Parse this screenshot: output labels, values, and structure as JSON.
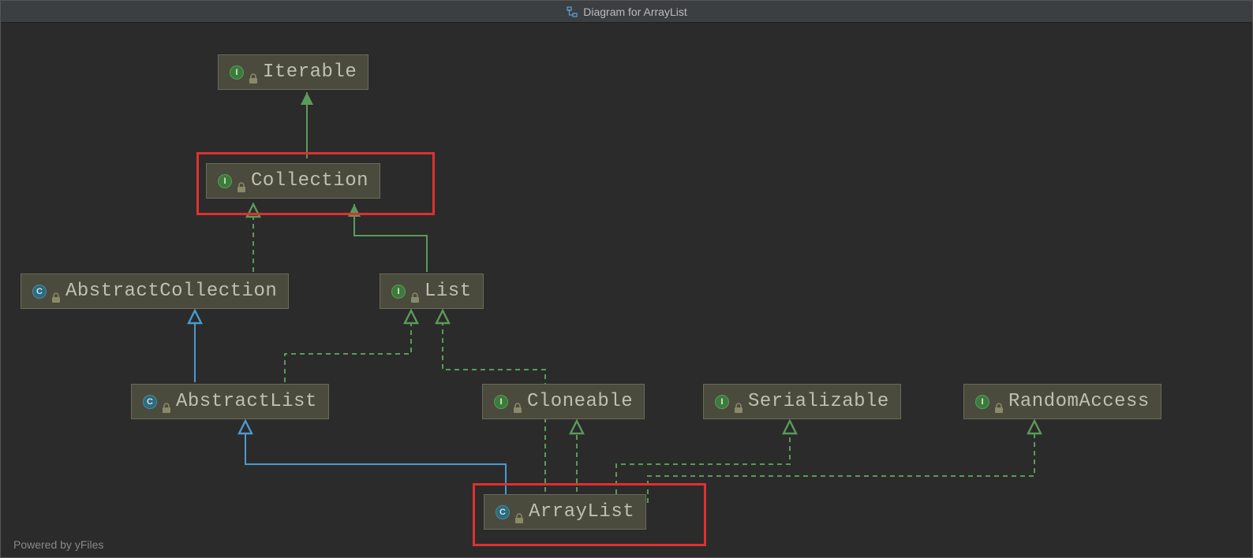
{
  "title": "Diagram for ArrayList",
  "footer": "Powered by yFiles",
  "nodes": {
    "iterable": {
      "label": "Iterable",
      "type": "I"
    },
    "collection": {
      "label": "Collection",
      "type": "I"
    },
    "abstractCollection": {
      "label": "AbstractCollection",
      "type": "C"
    },
    "list": {
      "label": "List",
      "type": "I"
    },
    "abstractList": {
      "label": "AbstractList",
      "type": "C"
    },
    "cloneable": {
      "label": "Cloneable",
      "type": "I"
    },
    "serializable": {
      "label": "Serializable",
      "type": "I"
    },
    "randomAccess": {
      "label": "RandomAccess",
      "type": "I"
    },
    "arrayList": {
      "label": "ArrayList",
      "type": "C"
    }
  },
  "edges": [
    {
      "from": "collection",
      "to": "iterable",
      "style": "solid-green"
    },
    {
      "from": "abstractCollection",
      "to": "collection",
      "style": "dashed-green"
    },
    {
      "from": "list",
      "to": "collection",
      "style": "solid-green"
    },
    {
      "from": "abstractList",
      "to": "abstractCollection",
      "style": "solid-blue"
    },
    {
      "from": "abstractList",
      "to": "list",
      "style": "dashed-green"
    },
    {
      "from": "arrayList",
      "to": "abstractList",
      "style": "solid-blue"
    },
    {
      "from": "arrayList",
      "to": "list",
      "style": "dashed-green"
    },
    {
      "from": "arrayList",
      "to": "cloneable",
      "style": "dashed-green"
    },
    {
      "from": "arrayList",
      "to": "serializable",
      "style": "dashed-green"
    },
    {
      "from": "arrayList",
      "to": "randomAccess",
      "style": "dashed-green"
    }
  ],
  "highlighted": [
    "collection",
    "arrayList"
  ],
  "chart_data": {
    "type": "diagram",
    "description": "Java class hierarchy diagram for ArrayList showing inheritance and interface implementation",
    "nodes": [
      {
        "id": "Iterable",
        "kind": "interface"
      },
      {
        "id": "Collection",
        "kind": "interface"
      },
      {
        "id": "AbstractCollection",
        "kind": "abstract-class"
      },
      {
        "id": "List",
        "kind": "interface"
      },
      {
        "id": "AbstractList",
        "kind": "abstract-class"
      },
      {
        "id": "Cloneable",
        "kind": "interface"
      },
      {
        "id": "Serializable",
        "kind": "interface"
      },
      {
        "id": "RandomAccess",
        "kind": "interface"
      },
      {
        "id": "ArrayList",
        "kind": "class"
      }
    ],
    "relationships": [
      {
        "from": "Collection",
        "to": "Iterable",
        "relation": "extends"
      },
      {
        "from": "AbstractCollection",
        "to": "Collection",
        "relation": "implements"
      },
      {
        "from": "List",
        "to": "Collection",
        "relation": "extends"
      },
      {
        "from": "AbstractList",
        "to": "AbstractCollection",
        "relation": "extends"
      },
      {
        "from": "AbstractList",
        "to": "List",
        "relation": "implements"
      },
      {
        "from": "ArrayList",
        "to": "AbstractList",
        "relation": "extends"
      },
      {
        "from": "ArrayList",
        "to": "List",
        "relation": "implements"
      },
      {
        "from": "ArrayList",
        "to": "Cloneable",
        "relation": "implements"
      },
      {
        "from": "ArrayList",
        "to": "Serializable",
        "relation": "implements"
      },
      {
        "from": "ArrayList",
        "to": "RandomAccess",
        "relation": "implements"
      }
    ]
  }
}
